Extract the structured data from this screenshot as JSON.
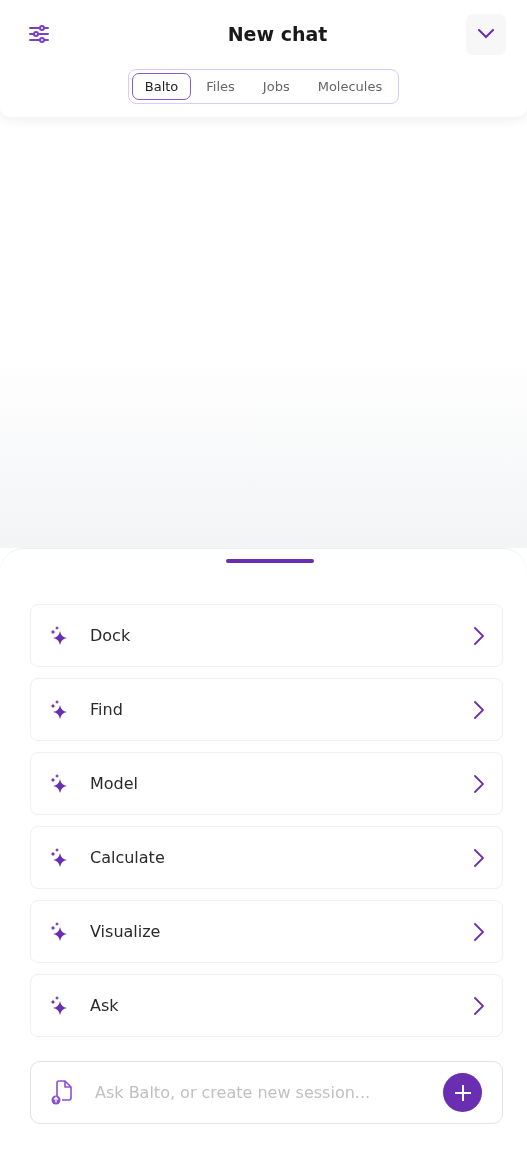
{
  "header": {
    "title": "New chat"
  },
  "tabs": [
    {
      "label": "Balto",
      "selected": true
    },
    {
      "label": "Files",
      "selected": false
    },
    {
      "label": "Jobs",
      "selected": false
    },
    {
      "label": "Molecules",
      "selected": false
    }
  ],
  "actions": [
    {
      "label": "Dock"
    },
    {
      "label": "Find"
    },
    {
      "label": "Model"
    },
    {
      "label": "Calculate"
    },
    {
      "label": "Visualize"
    },
    {
      "label": "Ask"
    }
  ],
  "composer": {
    "placeholder": "Ask Balto, or create new session..."
  }
}
